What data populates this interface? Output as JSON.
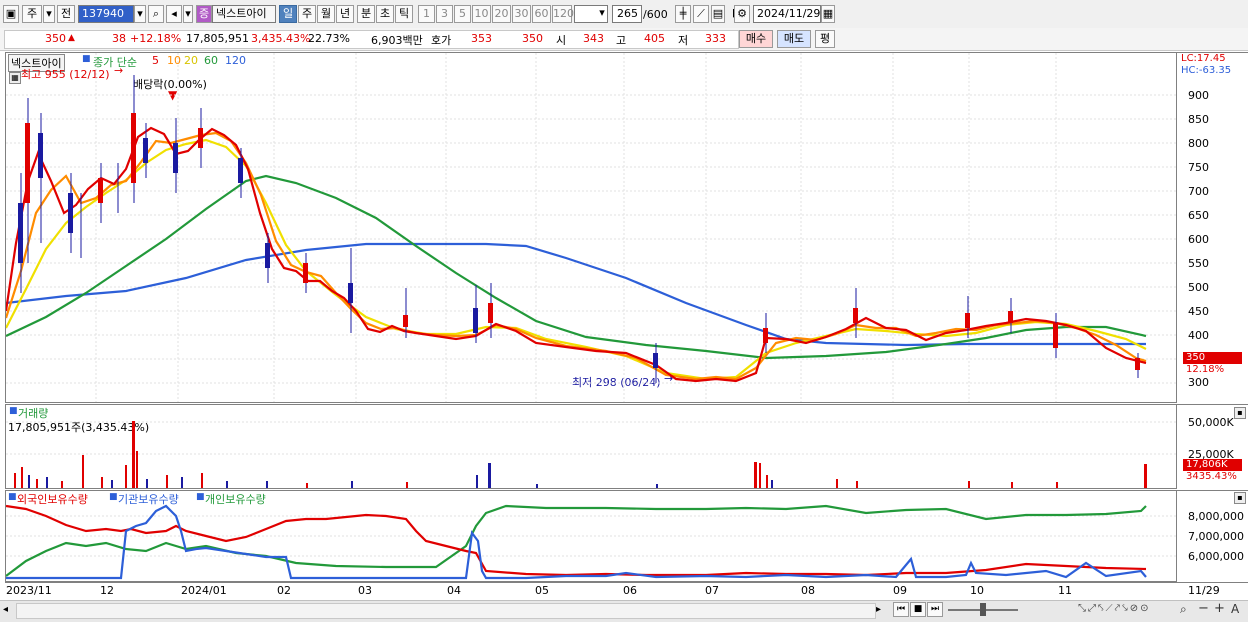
{
  "toolbar": {
    "period_code": "주",
    "compare_label": "전",
    "stock_code": "137940",
    "stock_badge": "증",
    "stock_name": "넥스트아이",
    "periods": [
      "일",
      "주",
      "월",
      "년",
      "분",
      "초",
      "틱"
    ],
    "active_period": "일",
    "intervals": [
      "1",
      "3",
      "5",
      "10",
      "20",
      "30",
      "60",
      "120"
    ],
    "count_value": "265",
    "count_total": "/600",
    "date_value": "2024/11/29"
  },
  "quote": {
    "price": "350",
    "change": "38",
    "change_pct": "+12.18%",
    "volume": "17,805,951",
    "volume_pct": "3,435.43%",
    "turnover": "22.73%",
    "amount": "6,903백만",
    "hoga_label": "호가",
    "bid": "353",
    "ask": "350",
    "open_label": "시",
    "open": "343",
    "high_label": "고",
    "high": "405",
    "low_label": "저",
    "low": "333",
    "buy_label": "매수",
    "sell_label": "매도",
    "avg_label": "평"
  },
  "price_pane": {
    "name_tag": "넥스트아이",
    "ma_label": "종가 단순",
    "ma_periods": [
      "5",
      "10",
      "20",
      "60",
      "120"
    ],
    "ma_colors": [
      "#e00000",
      "#ff8c00",
      "#f0e000",
      "#22993a",
      "#2d5fd8"
    ],
    "high_note": "최고 955 (12/12)",
    "low_note": "최저 298 (06/24)",
    "dividend_note": "배당락(0.00%)",
    "lc_label": "LC:17.45",
    "hc_label": "HC:-63.35",
    "y_ticks": [
      "900",
      "850",
      "800",
      "750",
      "700",
      "650",
      "600",
      "550",
      "500",
      "450",
      "400",
      "350",
      "300"
    ],
    "last_price_tag": "350",
    "last_pct_tag": "12.18%"
  },
  "volume_pane": {
    "title": "거래량",
    "info": "17,805,951주(3,435.43%)",
    "y_ticks": [
      "50,000K",
      "25,000K"
    ],
    "last_tag": "17,806K",
    "last_pct": "3435.43%"
  },
  "holding_pane": {
    "series": [
      {
        "name": "외국인보유수량",
        "color": "#e00000"
      },
      {
        "name": "기관보유수량",
        "color": "#2d5fd8"
      },
      {
        "name": "개인보유수량",
        "color": "#22993a"
      }
    ],
    "y_ticks": [
      "8,000,000",
      "7,000,000",
      "6,000,000"
    ]
  },
  "x_axis": {
    "labels": [
      "2023/11",
      "12",
      "2024/01",
      "02",
      "03",
      "04",
      "05",
      "06",
      "07",
      "08",
      "09",
      "10",
      "11"
    ],
    "last_label": "11/29"
  },
  "chart_data": {
    "type": "candlestick",
    "y_range": [
      290,
      960
    ],
    "price_approx": [
      {
        "x": "2023/11",
        "close": 450
      },
      {
        "x": "2023/11",
        "close": 780
      },
      {
        "x": "2023/11",
        "close": 600
      },
      {
        "x": "12",
        "close": 720
      },
      {
        "x": "12",
        "close": 955
      },
      {
        "x": "12",
        "close": 820
      },
      {
        "x": "2024/01",
        "close": 820
      },
      {
        "x": "2024/01",
        "close": 700
      },
      {
        "x": "02",
        "close": 560
      },
      {
        "x": "02",
        "close": 520
      },
      {
        "x": "03",
        "close": 420
      },
      {
        "x": "03",
        "close": 400
      },
      {
        "x": "04",
        "close": 390
      },
      {
        "x": "04",
        "close": 420
      },
      {
        "x": "05",
        "close": 380
      },
      {
        "x": "05",
        "close": 370
      },
      {
        "x": "06",
        "close": 360
      },
      {
        "x": "06",
        "close": 298
      },
      {
        "x": "07",
        "close": 305
      },
      {
        "x": "07",
        "close": 370
      },
      {
        "x": "08",
        "close": 390
      },
      {
        "x": "08",
        "close": 410
      },
      {
        "x": "09",
        "close": 395
      },
      {
        "x": "09",
        "close": 400
      },
      {
        "x": "10",
        "close": 420
      },
      {
        "x": "10",
        "close": 430
      },
      {
        "x": "11",
        "close": 390
      },
      {
        "x": "11/29",
        "close": 350
      }
    ]
  }
}
